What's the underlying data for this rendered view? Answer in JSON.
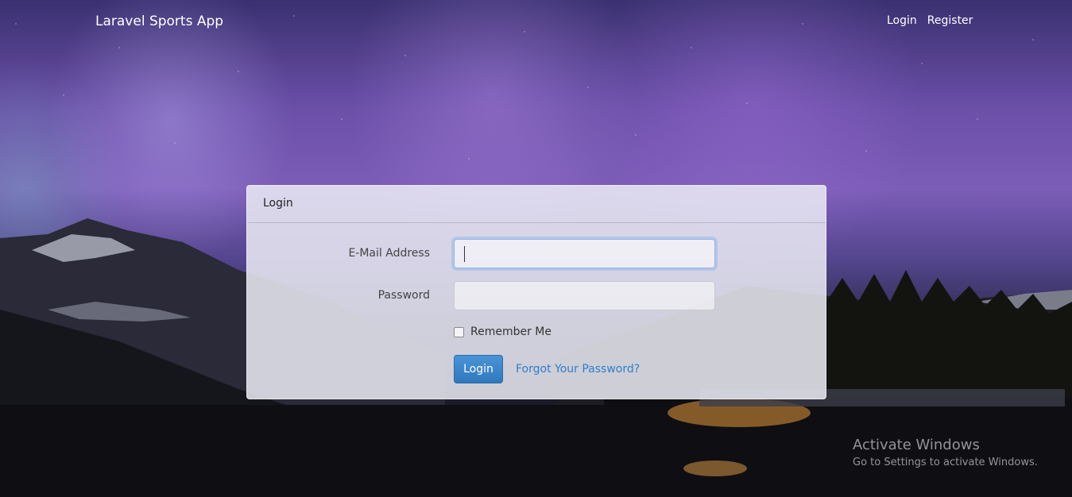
{
  "navbar": {
    "brand": "Laravel Sports App",
    "links": [
      "Login",
      "Register"
    ]
  },
  "login_card": {
    "header": "Login",
    "email_label": "E-Mail Address",
    "email_value": "",
    "password_label": "Password",
    "password_value": "",
    "remember_label": "Remember Me",
    "remember_checked": false,
    "submit_label": "Login",
    "forgot_label": "Forgot Your Password?"
  },
  "watermark": {
    "title": "Activate Windows",
    "subtitle": "Go to Settings to activate Windows."
  },
  "colors": {
    "primary_button": "#3a88cc",
    "link": "#2f7fc8"
  }
}
